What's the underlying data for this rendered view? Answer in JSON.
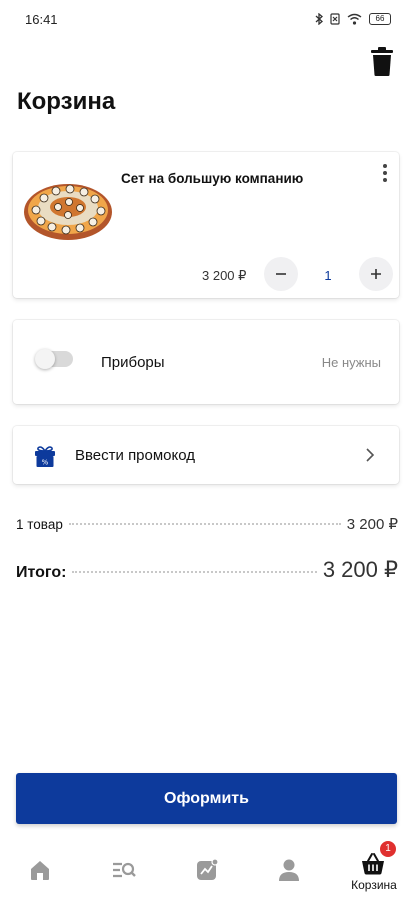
{
  "status_bar": {
    "time": "16:41",
    "battery": "66"
  },
  "header": {
    "title": "Корзина"
  },
  "cart_item": {
    "name": "Сет на большую компанию",
    "price": "3 200 ₽",
    "quantity": "1"
  },
  "cutlery": {
    "label": "Приборы",
    "status": "Не нужны",
    "enabled": false
  },
  "promo": {
    "label": "Ввести промокод",
    "icon": "gift-icon"
  },
  "summary": {
    "items_label": "1 товар",
    "items_value": "3 200 ₽",
    "total_label": "Итого:",
    "total_value": "3 200 ₽"
  },
  "checkout": {
    "label": "Оформить"
  },
  "bottom_nav": {
    "items": [
      {
        "icon": "home-icon"
      },
      {
        "icon": "catalog-search-icon"
      },
      {
        "icon": "promo-icon"
      },
      {
        "icon": "profile-icon"
      },
      {
        "icon": "cart-icon",
        "label": "Корзина",
        "badge": "1"
      }
    ]
  },
  "colors": {
    "accent": "#0d3a9c",
    "badge": "#e0302f",
    "nav_icon": "#9a9a9a"
  }
}
